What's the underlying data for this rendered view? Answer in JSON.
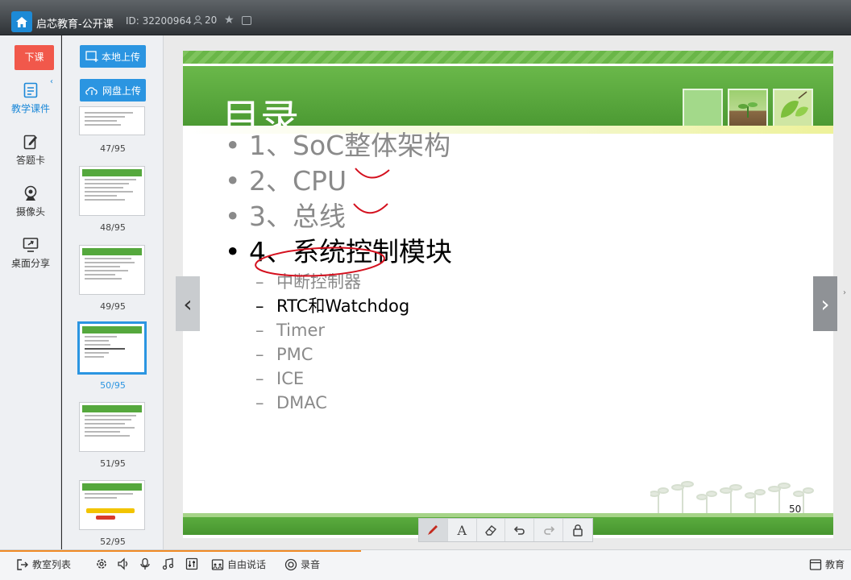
{
  "titlebar": {
    "title": "启芯教育-公开课",
    "id_text": "ID: 32200964",
    "participants": "20"
  },
  "left": {
    "end_class": "下课",
    "tools": [
      "教学课件",
      "答题卡",
      "摄像头",
      "桌面分享"
    ]
  },
  "thumbs": {
    "upload_local": "本地上传",
    "upload_cloud": "网盘上传",
    "pages": [
      "47/95",
      "48/95",
      "49/95",
      "50/95",
      "51/95",
      "52/95"
    ],
    "selected": "50/95"
  },
  "slide": {
    "title": "目录",
    "bullets": [
      "1、SoC整体架构",
      "2、CPU",
      "3、总线",
      "4、系统控制模块"
    ],
    "subbullets": [
      "中断控制器",
      "RTC和Watchdog",
      "Timer",
      "PMC",
      "ICE",
      "DMAC"
    ],
    "page_number": "50"
  },
  "bottombar": {
    "classroom_list": "教室列表",
    "free_talk": "自由说话",
    "record": "录音",
    "right_item": "教育"
  },
  "colors": {
    "accent": "#2b95e1",
    "end_class": "#f1584b",
    "slide_green": "#4c9a33",
    "annotation": "#d4101e"
  }
}
